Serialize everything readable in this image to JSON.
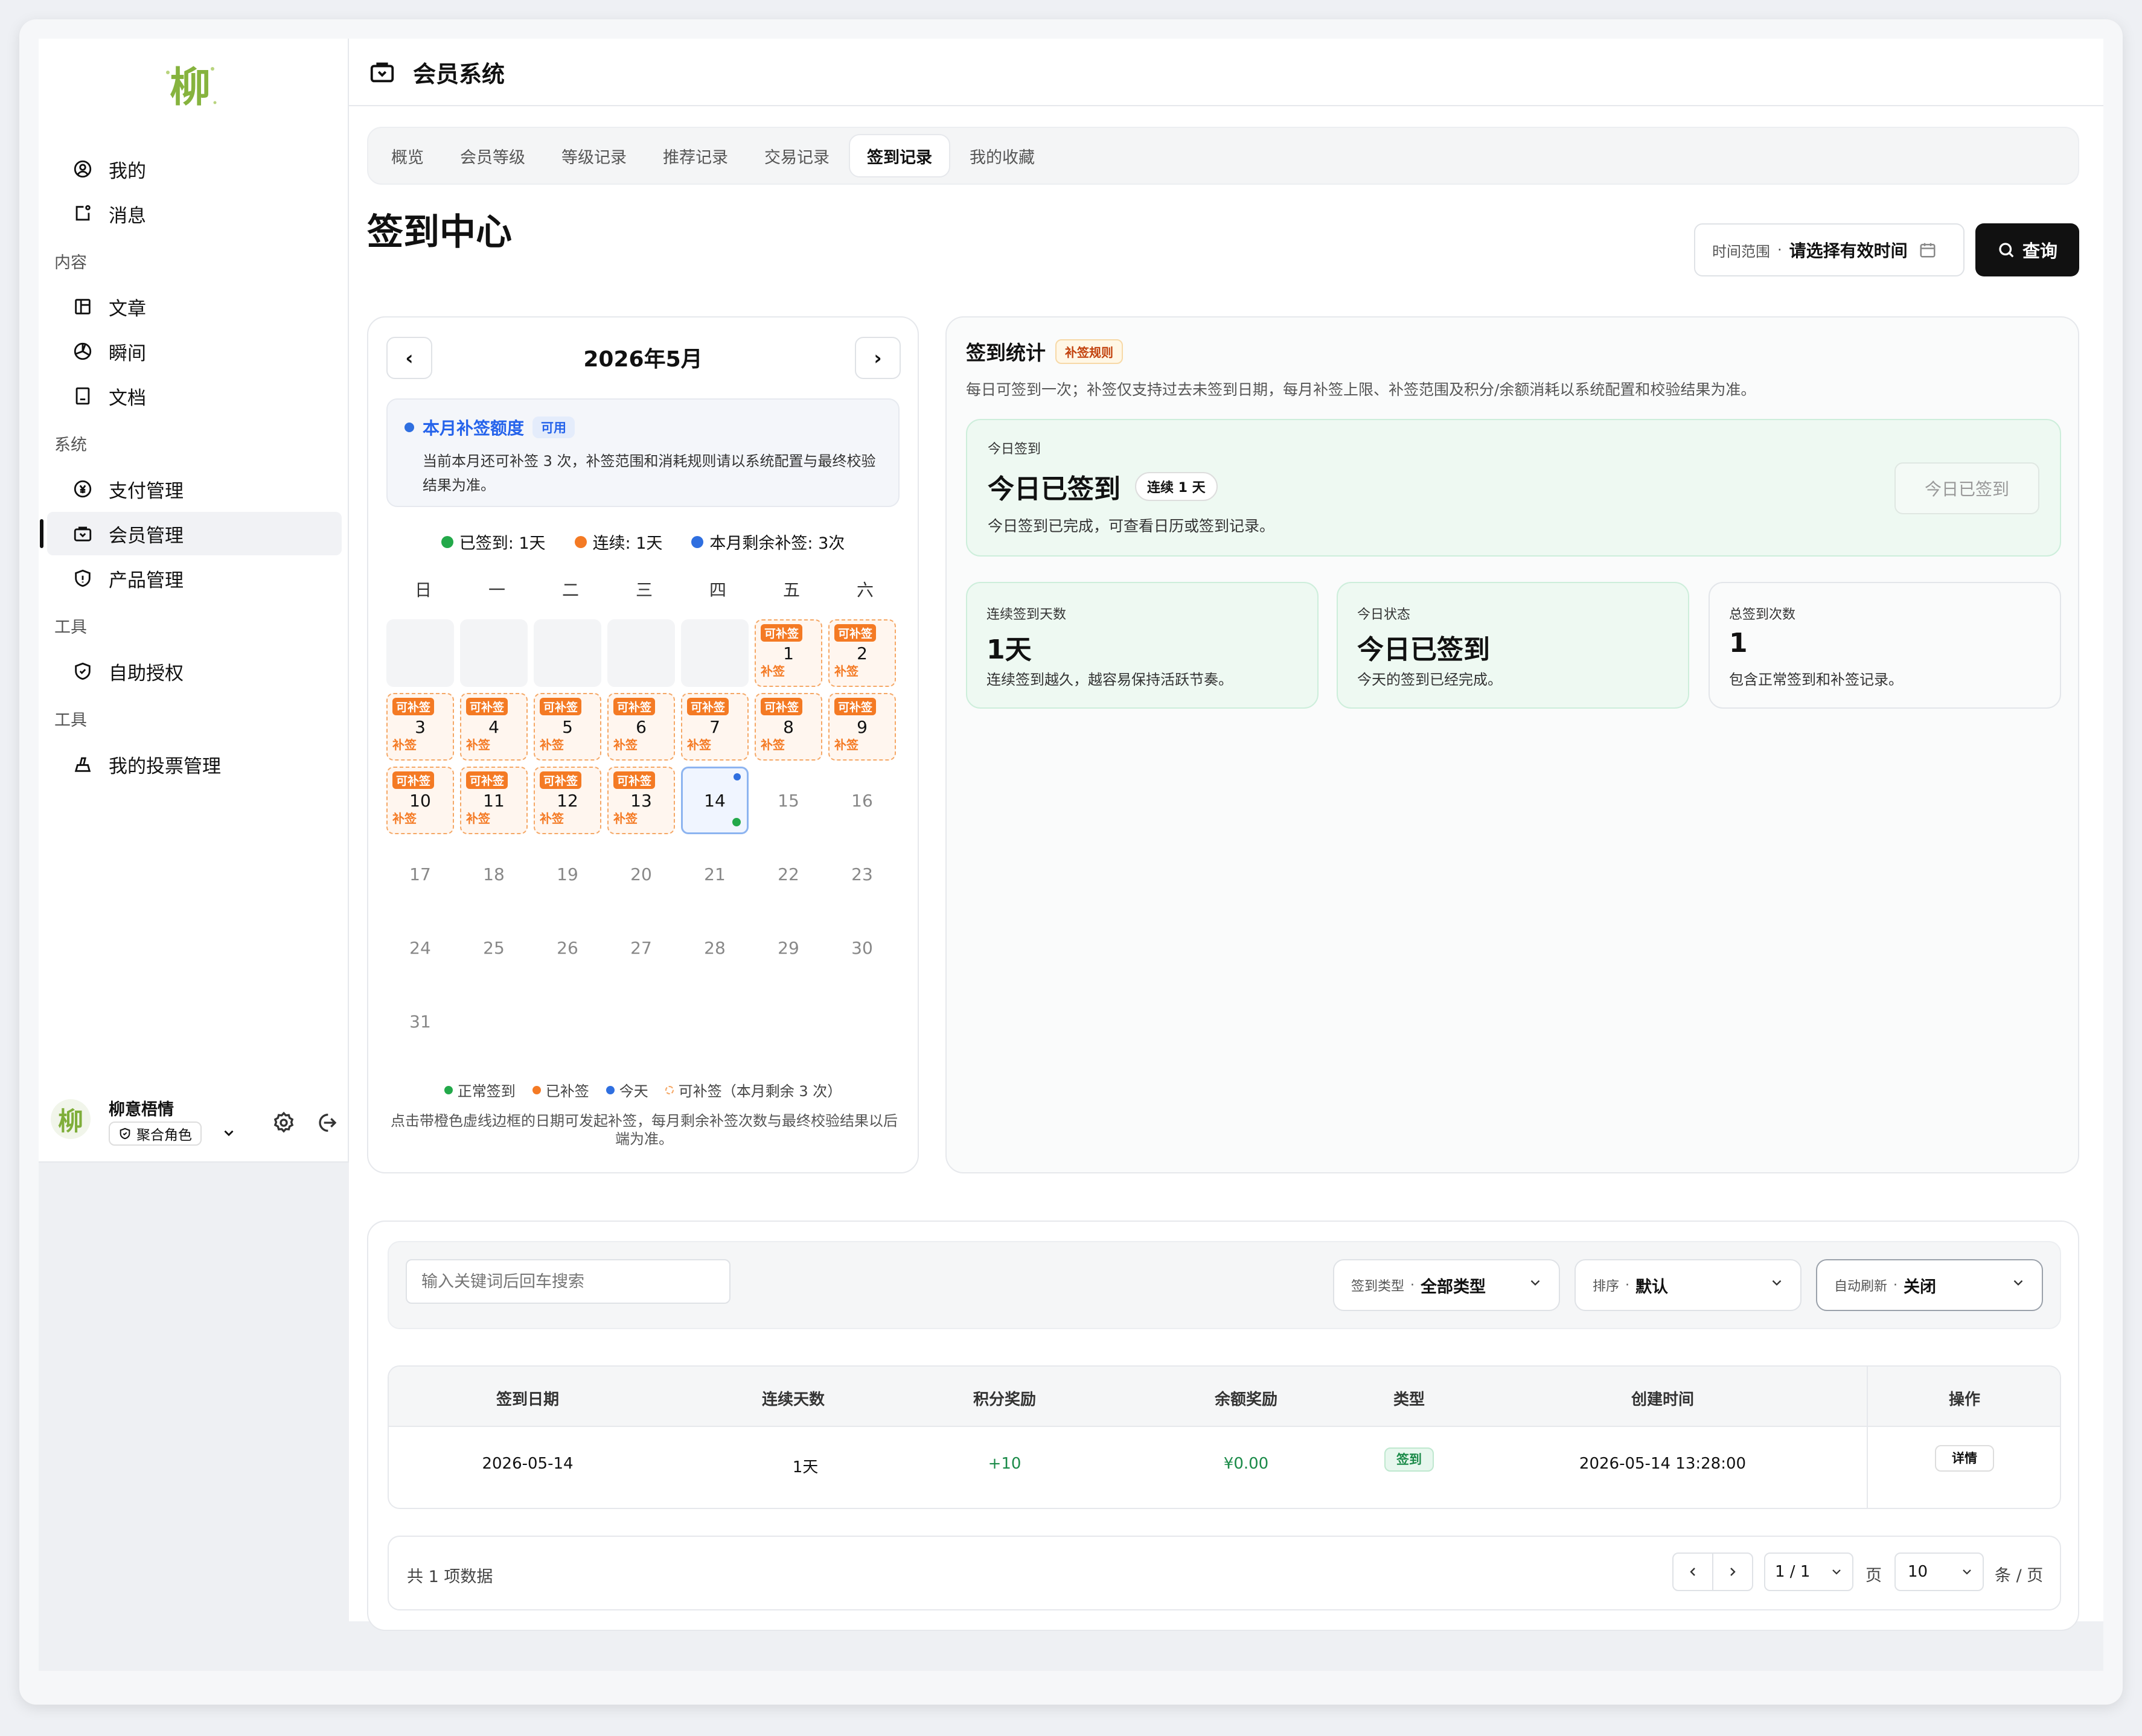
{
  "sidebar": {
    "logo_glyph": "柳",
    "items": [
      {
        "label": "我的",
        "icon": "user-circle-icon"
      },
      {
        "label": "消息",
        "icon": "message-icon"
      }
    ],
    "group_content": "内容",
    "content_items": [
      {
        "label": "文章",
        "icon": "article-icon"
      },
      {
        "label": "瞬间",
        "icon": "moment-icon"
      },
      {
        "label": "文档",
        "icon": "document-icon"
      }
    ],
    "group_system": "系统",
    "system_items": [
      {
        "label": "支付管理",
        "icon": "payment-icon"
      },
      {
        "label": "会员管理",
        "icon": "member-icon",
        "active": true
      },
      {
        "label": "产品管理",
        "icon": "product-icon"
      }
    ],
    "group_tools1": "工具",
    "tools1_items": [
      {
        "label": "自助授权",
        "icon": "auth-shield-icon"
      }
    ],
    "group_tools2": "工具",
    "tools2_items": [
      {
        "label": "我的投票管理",
        "icon": "vote-icon"
      }
    ],
    "user": {
      "avatar_glyph": "柳",
      "name": "柳意梧情",
      "role": "聚合角色"
    }
  },
  "header": {
    "title": "会员系统"
  },
  "tabs": [
    "概览",
    "会员等级",
    "等级记录",
    "推荐记录",
    "交易记录",
    "签到记录",
    "我的收藏"
  ],
  "active_tab": "签到记录",
  "page_title": "签到中心",
  "time_range": {
    "label": "时间范围",
    "placeholder": "请选择有效时间"
  },
  "query_button": "查询",
  "calendar": {
    "month": "2026年5月",
    "prev": "‹",
    "next": "›",
    "quota_title": "本月补签额度",
    "quota_badge": "可用",
    "quota_desc": "当前本月还可补签 3 次，补签范围和消耗规则请以系统配置与最终校验结果为准。",
    "summary": {
      "signed": "已签到: 1天",
      "streak": "连续: 1天",
      "remaining": "本月剩余补签: 3次"
    },
    "weekdays": [
      "日",
      "一",
      "二",
      "三",
      "四",
      "五",
      "六"
    ],
    "makeup_tag": "可补签",
    "makeup_sub": "补签",
    "leading_empty": 5,
    "days_in_month": 31,
    "makeup_days": [
      1,
      2,
      3,
      4,
      5,
      6,
      7,
      8,
      9,
      10,
      11,
      12,
      13
    ],
    "today": 14,
    "legend": {
      "normal": "正常签到",
      "makeup": "已补签",
      "today": "今天",
      "available": "可补签（本月剩余 3 次）"
    },
    "note": "点击带橙色虚线边框的日期可发起补签，每月剩余补签次数与最终校验结果以后端为准。",
    "colors": {
      "normal": "#23a94a",
      "makeup": "#f47a24",
      "today": "#2f6fe0"
    }
  },
  "stats": {
    "title": "签到统计",
    "rule_badge": "补签规则",
    "desc": "每日可签到一次；补签仅支持过去未签到日期，每月补签上限、补签范围及积分/余额消耗以系统配置和校验结果为准。",
    "today": {
      "label": "今日签到",
      "status": "今日已签到",
      "streak_badge": "连续 1 天",
      "desc": "今日签到已完成，可查看日历或签到记录。",
      "button": "今日已签到"
    },
    "cards": [
      {
        "label": "连续签到天数",
        "value": "1天",
        "desc": "连续签到越久，越容易保持活跃节奏。"
      },
      {
        "label": "今日状态",
        "value": "今日已签到",
        "desc": "今天的签到已经完成。"
      },
      {
        "label": "总签到次数",
        "value": "1",
        "desc": "包含正常签到和补签记录。"
      }
    ]
  },
  "filters": {
    "search_placeholder": "输入关键词后回车搜索",
    "type": {
      "label": "签到类型",
      "value": "全部类型"
    },
    "sort": {
      "label": "排序",
      "value": "默认"
    },
    "refresh": {
      "label": "自动刷新",
      "value": "关闭"
    }
  },
  "table": {
    "headers": [
      "签到日期",
      "连续天数",
      "积分奖励",
      "余额奖励",
      "类型",
      "创建时间",
      "操作"
    ],
    "rows": [
      {
        "date": "2026-05-14",
        "streak": "1天",
        "points": "+10",
        "balance": "¥0.00",
        "type": "签到",
        "created": "2026-05-14 13:28:00",
        "action": "详情"
      }
    ]
  },
  "pager": {
    "total": "共 1 项数据",
    "page": "1 / 1",
    "page_unit": "页",
    "size": "10",
    "size_unit": "条 / 页"
  }
}
